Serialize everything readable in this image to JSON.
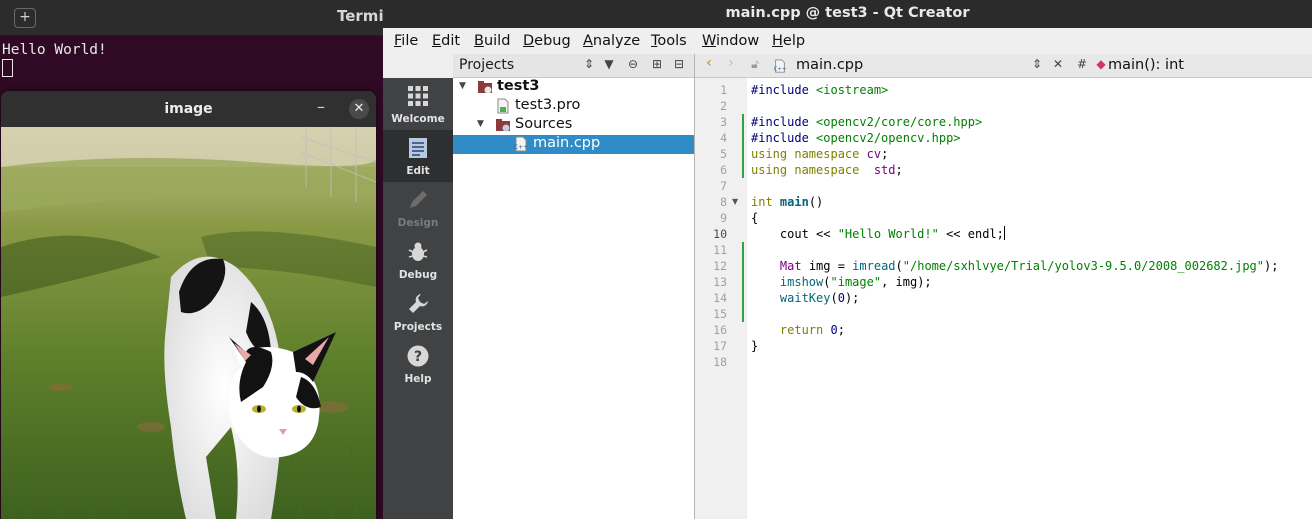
{
  "terminal": {
    "title": "Termin",
    "output": "Hello World!"
  },
  "image_window": {
    "title": "image",
    "minimize": "–",
    "close": "✕"
  },
  "qt": {
    "title": "main.cpp @ test3 - Qt Creator",
    "menu": [
      "File",
      "Edit",
      "Build",
      "Debug",
      "Analyze",
      "Tools",
      "Window",
      "Help"
    ],
    "modes": [
      {
        "label": "Welcome",
        "icon": "grid-icon",
        "active": false,
        "enabled": true
      },
      {
        "label": "Edit",
        "icon": "document-icon",
        "active": true,
        "enabled": true
      },
      {
        "label": "Design",
        "icon": "pencil-icon",
        "active": false,
        "enabled": false
      },
      {
        "label": "Debug",
        "icon": "bug-icon",
        "active": false,
        "enabled": true
      },
      {
        "label": "Projects",
        "icon": "wrench-icon",
        "active": false,
        "enabled": true
      },
      {
        "label": "Help",
        "icon": "help-icon",
        "active": false,
        "enabled": true
      }
    ],
    "projects_pane": {
      "title": "Projects",
      "tree": [
        {
          "label": "test3",
          "level": 0,
          "bold": true,
          "icon": "project-folder-icon",
          "expanded": true
        },
        {
          "label": "test3.pro",
          "level": 1,
          "bold": false,
          "icon": "pro-file-icon"
        },
        {
          "label": "Sources",
          "level": 1,
          "bold": false,
          "icon": "sources-folder-icon",
          "expanded": true
        },
        {
          "label": "main.cpp",
          "level": 2,
          "bold": false,
          "icon": "cpp-file-icon",
          "selected": true
        }
      ]
    },
    "editor": {
      "file": "main.cpp",
      "function": "main(): int",
      "current_line": 10,
      "lines": [
        "#include <iostream>",
        "",
        "#include <opencv2/core/core.hpp>",
        "#include <opencv2/opencv.hpp>",
        "using namespace cv;",
        "using namespace  std;",
        "",
        "int main()",
        "{",
        "    cout << \"Hello World!\" << endl;",
        "",
        "    Mat img = imread(\"/home/sxhlvye/Trial/yolov3-9.5.0/2008_002682.jpg\");",
        "    imshow(\"image\", img);",
        "    waitKey(0);",
        "",
        "    return 0;",
        "}",
        ""
      ]
    }
  }
}
